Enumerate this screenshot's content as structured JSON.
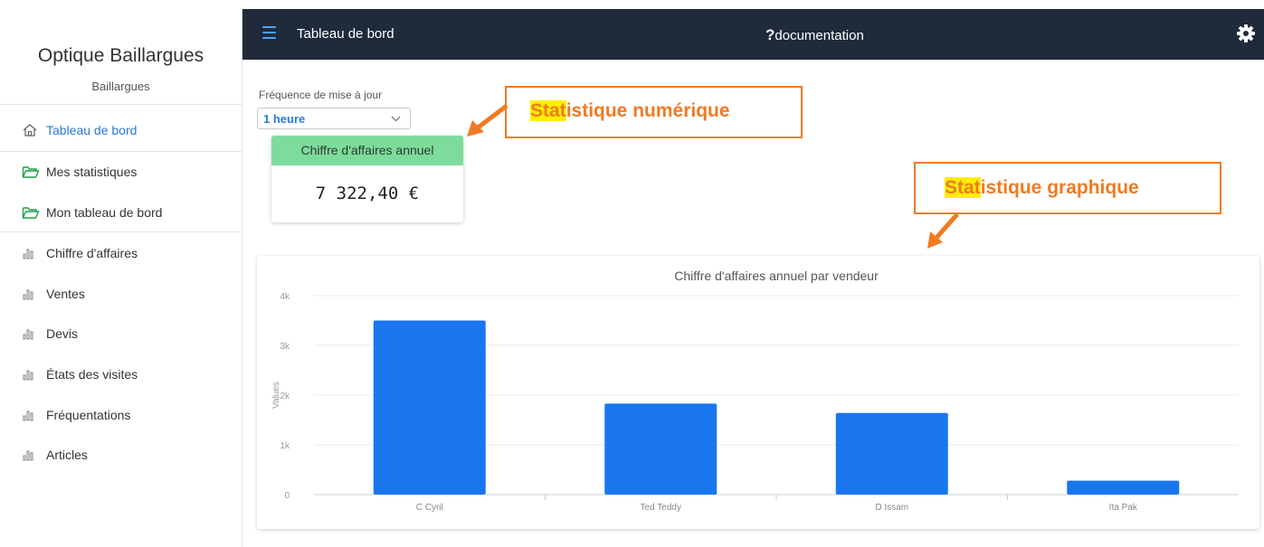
{
  "sidebar": {
    "brand_title": "Optique Baillargues",
    "brand_subtitle": "Baillargues",
    "items": [
      {
        "label": "Tableau de bord",
        "icon": "home-icon",
        "active": true
      },
      {
        "label": "Mes statistiques",
        "icon": "folder-open-icon"
      },
      {
        "label": "Mon tableau de bord",
        "icon": "folder-open-icon"
      },
      {
        "label": "Chiffre d'affaires",
        "icon": "bar-chart-icon"
      },
      {
        "label": "Ventes",
        "icon": "bar-chart-icon"
      },
      {
        "label": "Devis",
        "icon": "bar-chart-icon"
      },
      {
        "label": "États des visites",
        "icon": "bar-chart-icon"
      },
      {
        "label": "Fréquentations",
        "icon": "bar-chart-icon"
      },
      {
        "label": "Articles",
        "icon": "bar-chart-icon"
      }
    ]
  },
  "topbar": {
    "title": "Tableau de bord",
    "doc_label": "documentation"
  },
  "frequency": {
    "label": "Fréquence de mise à jour",
    "value": "1 heure"
  },
  "kpi": {
    "title": "Chiffre d'affaires annuel",
    "value": "7 322,40 €"
  },
  "annotations": {
    "numeric_hl": "Stat",
    "numeric_rest": "istique numérique",
    "graphic_hl": "Stat",
    "graphic_rest": "istique graphique"
  },
  "colors": {
    "topbar": "#1f2a3b",
    "accent": "#2a7ad6",
    "kpi_header": "#7ddc9c",
    "bar": "#1a76ef",
    "annotation": "#f07a22",
    "highlight": "#ffef00"
  },
  "chart_data": {
    "type": "bar",
    "title": "Chiffre d'affaires annuel par vendeur",
    "ylabel": "Values",
    "xlabel": "",
    "categories": [
      "C Cyril",
      "Ted Teddy",
      "D Issam",
      "Ita Pak"
    ],
    "values": [
      3500,
      1830,
      1640,
      280
    ],
    "ylim": [
      0,
      4000
    ],
    "yticks": [
      0,
      1000,
      2000,
      3000,
      4000
    ],
    "ytick_labels": [
      "0",
      "1k",
      "2k",
      "3k",
      "4k"
    ],
    "grid": true,
    "legend": "none"
  }
}
